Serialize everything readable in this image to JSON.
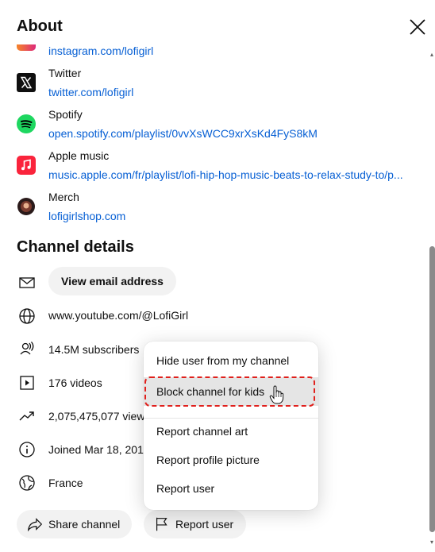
{
  "header": {
    "title": "About"
  },
  "links": [
    {
      "title": "",
      "url": "instagram.com/lofigirl",
      "icon": "instagram-icon"
    },
    {
      "title": "Twitter",
      "url": "twitter.com/lofigirl",
      "icon": "x-twitter-icon"
    },
    {
      "title": "Spotify",
      "url": "open.spotify.com/playlist/0vvXsWCC9xrXsKd4FyS8kM",
      "icon": "spotify-icon"
    },
    {
      "title": "Apple music",
      "url": "music.apple.com/fr/playlist/lofi-hip-hop-music-beats-to-relax-study-to/p...",
      "icon": "apple-music-icon"
    },
    {
      "title": "Merch",
      "url": "lofigirlshop.com",
      "icon": "merch-avatar-icon"
    }
  ],
  "channel_details": {
    "title": "Channel details",
    "email_button": "View email address",
    "url": "www.youtube.com/@LofiGirl",
    "subscribers": "14.5M subscribers",
    "videos": "176 videos",
    "views": "2,075,475,077 views",
    "joined": "Joined Mar 18, 2015",
    "country": "France"
  },
  "actions": {
    "share": "Share channel",
    "report": "Report user"
  },
  "menu": {
    "items": [
      "Hide user from my channel",
      "Block channel for kids",
      "Report channel art",
      "Report profile picture",
      "Report user"
    ]
  },
  "colors": {
    "link": "#065fd4",
    "highlight": "#e0201c",
    "spotify": "#1ed760",
    "apple_music": "#fa243c"
  }
}
